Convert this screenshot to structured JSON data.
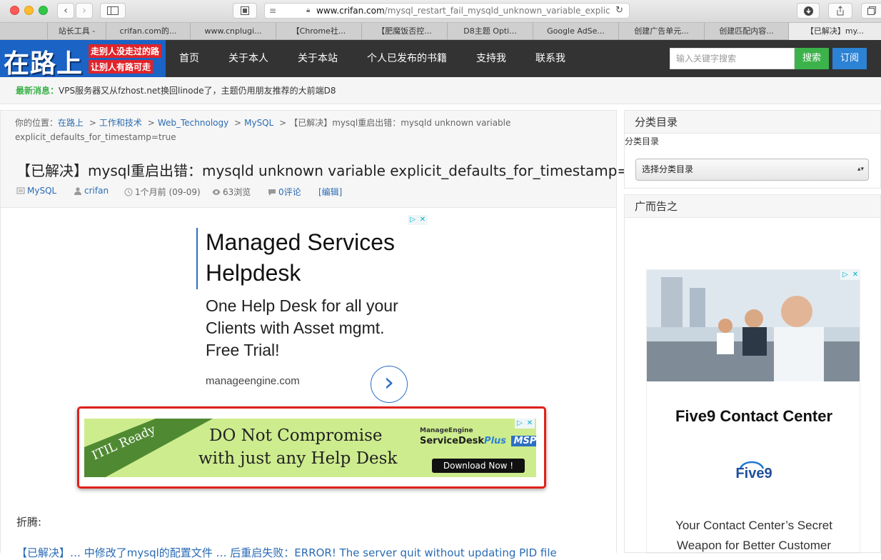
{
  "browser": {
    "url_domain": "www.crifan.com",
    "url_path": "/mysql_restart_fail_mysqld_unknown_variable_explic",
    "tabs": [
      "站长工具 -",
      "crifan.com的...",
      "www.cnplugi...",
      "【Chrome社...",
      "【肥魔饭否控...",
      "D8主题 Opti...",
      "Google AdSe...",
      "创建广告单元...",
      "创建匹配内容...",
      "【已解决】my..."
    ]
  },
  "site": {
    "logo_main": "在路上",
    "logo_line1": "走别人没走过的路",
    "logo_line2": "让别人有路可走",
    "nav": [
      "首页",
      "关于本人",
      "关于本站",
      "个人已发布的书籍",
      "支持我",
      "联系我"
    ],
    "search_placeholder": "输入关键字搜索",
    "search_button": "搜索",
    "subscribe_button": "订阅",
    "news_label": "最新消息：",
    "news_text": "VPS服务器又从fzhost.net换回linode了，主题仍用朋友推荐的大前端D8"
  },
  "breadcrumb": {
    "prefix": "你的位置：",
    "links": [
      "在路上",
      "工作和技术",
      "Web_Technology",
      "MySQL"
    ],
    "sep": ">",
    "current_1": "【已解决】mysql重启出错：mysqld unknown variable",
    "current_2": "explicit_defaults_for_timestamp=true"
  },
  "article": {
    "title": "【已解决】mysql重启出错：mysqld unknown variable explicit_defaults_for_timestamp=true",
    "category": "MySQL",
    "author": "crifan",
    "time": "1个月前 (09-09)",
    "views": "63浏览",
    "comments": "0评论",
    "edit": "[编辑]",
    "body_heading": "折腾:",
    "body_partial": "【已解决】… 中修改了mysql的配置文件 … 后重启失败：ERROR! The server quit without updating PID file"
  },
  "ad1": {
    "headline_1": "Managed Services",
    "headline_2": "Helpdesk",
    "body_1": "One Help Desk for all your",
    "body_2": "Clients with Asset mgmt.",
    "body_3": "Free Trial!",
    "domain": "manageengine.com",
    "arrow_icon": "›"
  },
  "ad2": {
    "ribbon": "ITIL Ready",
    "line1": "DO Not Compromise",
    "line2": "with just any Help Desk",
    "brand_top": "ManageEngine",
    "brand_main": "ServiceDesk",
    "brand_plus": "Plus",
    "brand_msp": "MSP",
    "cta": "Download Now !",
    "highlight_color": "#e0201a"
  },
  "sidebar": {
    "categories_title": "分类目录",
    "categories_label": "分类目录",
    "categories_select": "选择分类目录",
    "ad_title": "广而告之",
    "ad_headline": "Five9 Contact Center",
    "ad_logo": "Five9",
    "ad_body_1": "Your Contact Center’s Secret",
    "ad_body_2": "Weapon for Better Customer"
  },
  "colors": {
    "nav_bg": "#333333",
    "logo_bg": "#1b63c5",
    "search_btn": "#3cb34a",
    "subscribe_btn": "#2c82d4",
    "link": "#2a6bb3",
    "news_label": "#3cb34a"
  }
}
